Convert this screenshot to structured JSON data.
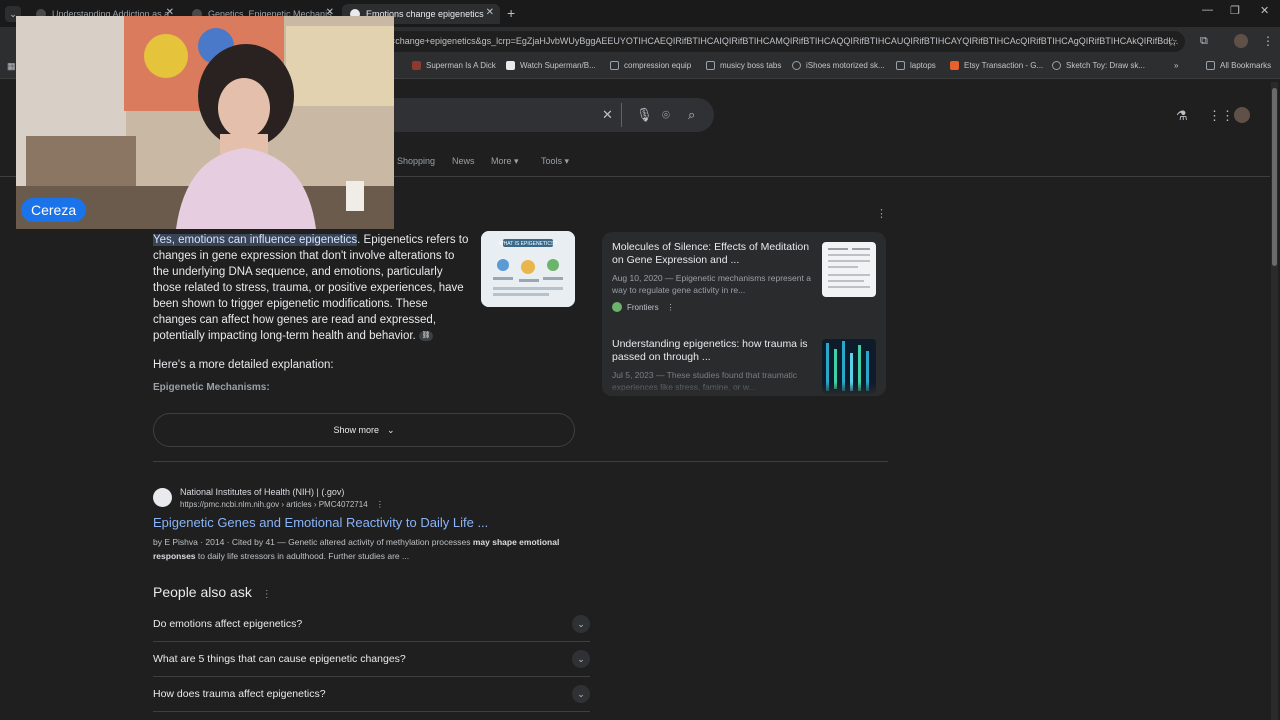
{
  "browser": {
    "tabs": [
      {
        "title": "Understanding Addiction as a"
      },
      {
        "title": "Genetics, Epigenetic Mechanis"
      },
      {
        "title": "Emotions change epigenetics",
        "active": true
      }
    ],
    "new_tab": "+",
    "url": "=change+epigenetics&gs_lcrp=EgZjaHJvbWUyBggAEEUYOTIHCAEQIRifBTIHCAIQIRifBTIHCAMQIRifBTIHCAQQIRifBTIHCAUQIRifBTIHCAYQIRifBTIHCAcQIRifBTIHCAgQIRifBTIHCAkQIRifBdI..."
  },
  "bookmarks": [
    {
      "label": "Superman Is A Dick",
      "icon": "bookmark-icon"
    },
    {
      "label": "Watch Superman/B...",
      "icon": "bookmark-icon"
    },
    {
      "label": "compression equip",
      "icon": "folder-icon"
    },
    {
      "label": "musicy boss tabs",
      "icon": "folder-icon"
    },
    {
      "label": "iShoes motorized sk...",
      "icon": "globe-icon"
    },
    {
      "label": "laptops",
      "icon": "folder-icon"
    },
    {
      "label": "Etsy Transaction - G...",
      "icon": "etsy-icon"
    },
    {
      "label": "Sketch Toy: Draw sk...",
      "icon": "globe-icon"
    },
    {
      "label": "All Bookmarks",
      "icon": "folder-icon"
    }
  ],
  "search": {
    "nav_tabs": [
      "Shopping",
      "News",
      "More",
      "Tools"
    ]
  },
  "overview": {
    "highlight": "Yes, emotions can influence epigenetics",
    "body": ". Epigenetics refers to changes in gene expression that don't involve alterations to the underlying DNA sequence, and emotions, particularly those related to stress, trauma, or positive experiences, have been shown to trigger epigenetic modifications. These changes can affect how genes are read and expressed, potentially impacting long-term health and behavior.",
    "thumb_label": "WHAT IS EPIGENETICS?",
    "detail_heading": "Here's a more detailed explanation:",
    "mechanisms_heading": "Epigenetic Mechanisms:",
    "show_more": "Show more"
  },
  "sources": [
    {
      "title": "Molecules of Silence: Effects of Meditation on Gene Expression and ...",
      "snippet": "Aug 10, 2020 — Epigenetic mechanisms represent a way to regulate gene activity in re...",
      "publisher": "Frontiers"
    },
    {
      "title": "Understanding epigenetics: how trauma is passed on through ...",
      "snippet": "Jul 5, 2023 — These studies found that traumatic experiences like stress, famine, or w..."
    }
  ],
  "result": {
    "site_name": "National Institutes of Health (NIH) | (.gov)",
    "url": "https://pmc.ncbi.nlm.nih.gov › articles › PMC4072714",
    "title": "Epigenetic Genes and Emotional Reactivity to Daily Life ...",
    "snippet_prefix": "by E Pishva · 2014 · Cited by 41 — Genetic altered activity of methylation processes ",
    "snippet_bold1": "may shape emotional responses",
    "snippet_suffix": " to daily life stressors in adulthood. Further studies are ..."
  },
  "people_also_ask": {
    "title": "People also ask",
    "questions": [
      "Do emotions affect epigenetics?",
      "What are 5 things that can cause epigenetic changes?",
      "How does trauma affect epigenetics?"
    ]
  },
  "webcam": {
    "name": "Cereza"
  },
  "colors": {
    "accent": "#1a73e8",
    "link": "#8ab4f8",
    "background": "#1f1f1f"
  }
}
